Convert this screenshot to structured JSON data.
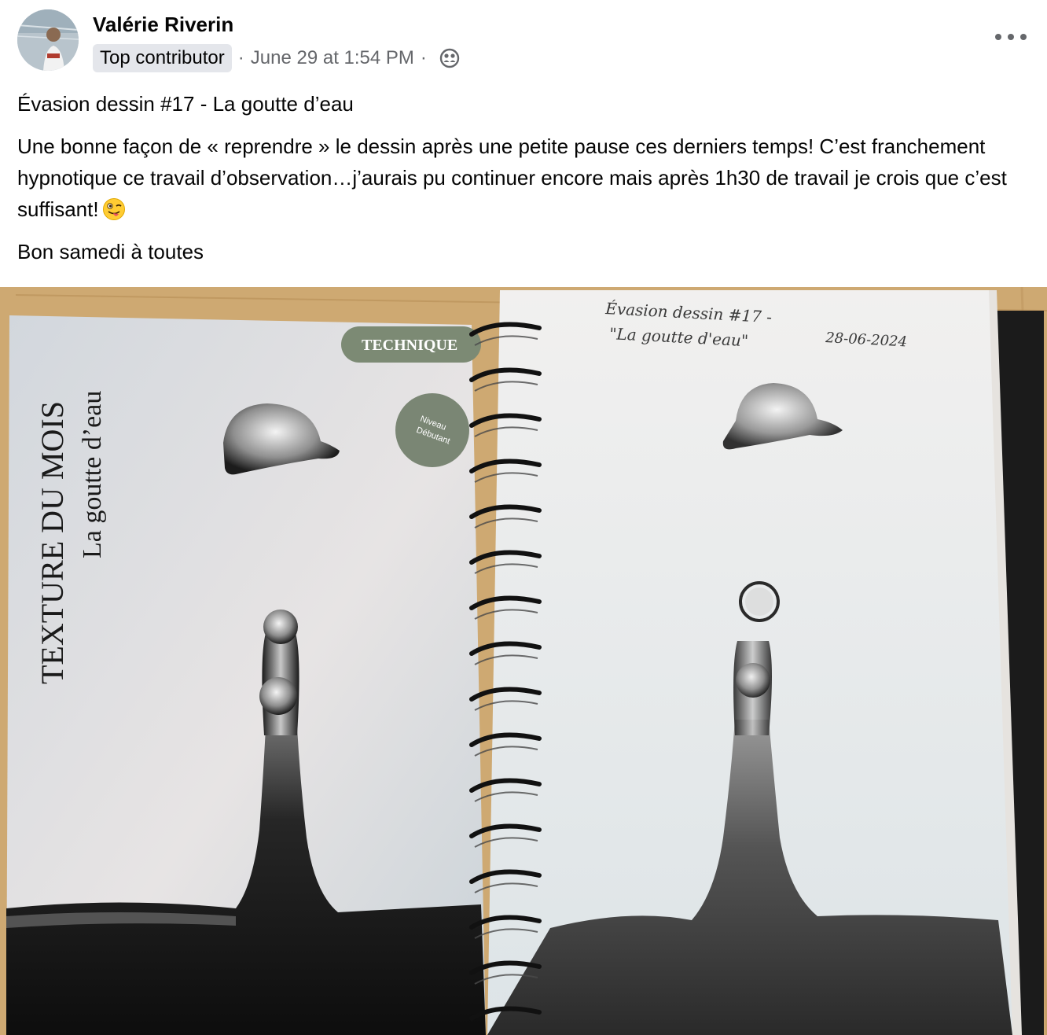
{
  "post": {
    "author": "Valérie Riverin",
    "badge": "Top contributor",
    "separator": "·",
    "timestamp": "June 29 at 1:54 PM",
    "audience_icon": "friends-audience-icon",
    "more_icon": "more-options-icon",
    "title_line": "Évasion dessin #17 - La goutte d’eau",
    "body_text": "Une bonne façon de « reprendre » le dessin après une petite pause ces derniers temps! C’est franchement hypnotique ce travail d’observation…j’aurais pu continuer encore mais après 1h30 de travail je crois que c’est suffisant!",
    "body_emoji": "winking-face-with-tongue",
    "closing_line": "Bon samedi à toutes"
  },
  "photo": {
    "left_page": {
      "tag": "TECHNIQUE",
      "level_line1": "Niveau",
      "level_line2": "Débutant",
      "vertical_title": "TEXTURE DU MOIS",
      "vertical_subtitle": "La goutte d’eau"
    },
    "right_page": {
      "handwritten_line1": "Évasion dessin #17 -",
      "handwritten_line2": "\"La goutte d'eau\"",
      "handwritten_date": "28-06-2024"
    }
  },
  "colors": {
    "text_primary": "#050505",
    "text_secondary": "#65676b",
    "badge_bg": "#e4e6eb",
    "tag_green": "#7c8a74",
    "table_wood": "#c9a36a"
  }
}
